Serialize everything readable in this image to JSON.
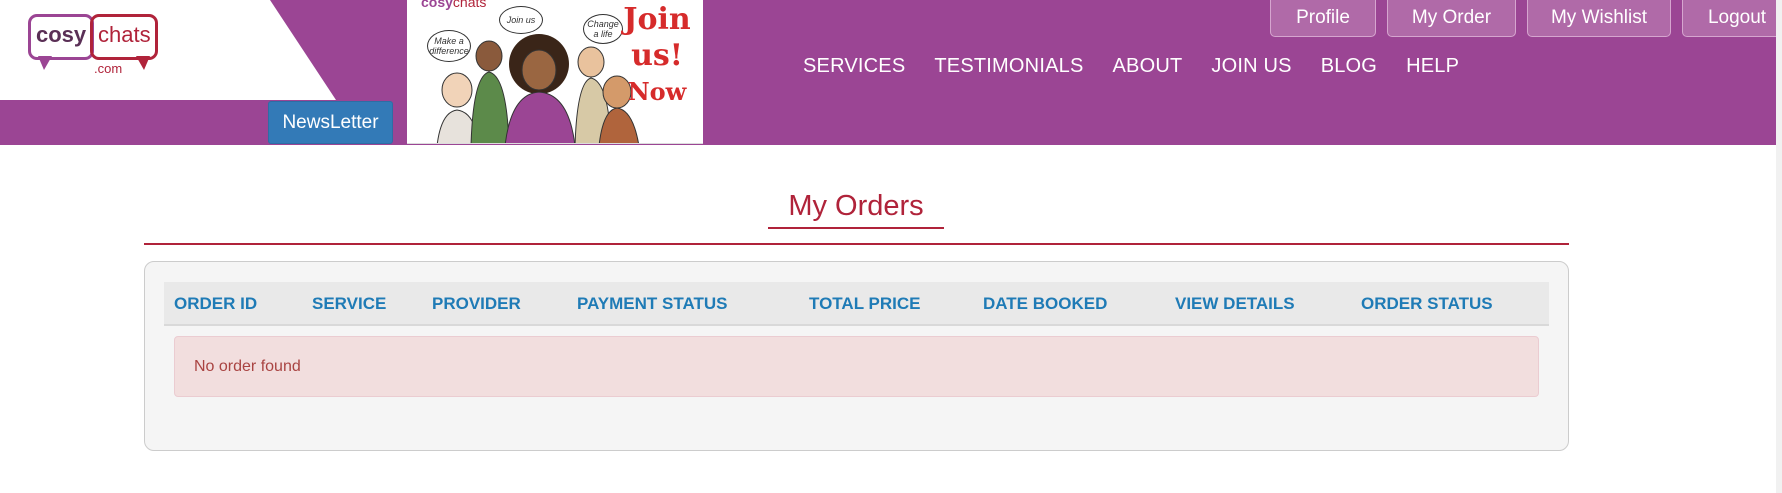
{
  "brand": {
    "logo_word1": "cosy",
    "logo_word2": "chats",
    "logo_domain": ".com",
    "primary_color": "#9b4594",
    "accent_color": "#b0233a"
  },
  "header": {
    "newsletter_label": "NewsLetter",
    "banner": {
      "join_line1": "Join",
      "join_line2": "us!",
      "join_line3": "Now",
      "bubble_1": "Join us",
      "bubble_2": "Make a difference",
      "bubble_3": "Change a life"
    },
    "user_buttons": [
      {
        "label": "Profile"
      },
      {
        "label": "My Order"
      },
      {
        "label": "My Wishlist"
      },
      {
        "label": "Logout"
      }
    ],
    "nav": [
      {
        "label": "SERVICES"
      },
      {
        "label": "TESTIMONIALS"
      },
      {
        "label": "ABOUT"
      },
      {
        "label": "JOIN US"
      },
      {
        "label": "BLOG"
      },
      {
        "label": "HELP"
      }
    ]
  },
  "main": {
    "title": "My Orders",
    "table": {
      "columns": [
        "ORDER ID",
        "SERVICE",
        "PROVIDER",
        "PAYMENT STATUS",
        "TOTAL PRICE",
        "DATE BOOKED",
        "VIEW DETAILS",
        "ORDER STATUS"
      ],
      "empty_message": "No order found"
    }
  }
}
